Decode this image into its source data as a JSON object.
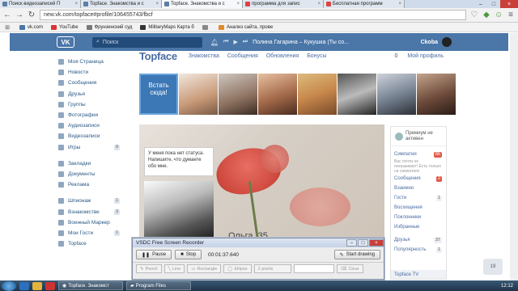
{
  "browser": {
    "tabs": [
      {
        "label": "Поиск видеозаписей П"
      },
      {
        "label": "Topface. Знакомства и с"
      },
      {
        "label": "Topface. Знакомства и с"
      },
      {
        "label": "программа для запис"
      },
      {
        "label": "Бесплатная программ"
      }
    ],
    "url": "new.vk.com/topface#profile/106455743/fbcf",
    "bookmarks": [
      {
        "label": "vk.com",
        "color": "#4a76a8"
      },
      {
        "label": "YouTube",
        "color": "#d33"
      },
      {
        "label": "Фрунзенский суд",
        "color": "#777"
      },
      {
        "label": "MilitaryMaps Карта б",
        "color": "#333"
      },
      {
        "label": "",
        "color": "#888"
      },
      {
        "label": "Анализ сайта, прове",
        "color": "#e08a2c"
      }
    ]
  },
  "vk": {
    "logo": "VK",
    "search_placeholder": "Поиск",
    "track": "Полина Гагарина – Кукушка (Ты со...",
    "user_name": "Ckoba"
  },
  "sidebar": {
    "items": [
      {
        "label": "Моя Страница",
        "badge": ""
      },
      {
        "label": "Новости",
        "badge": ""
      },
      {
        "label": "Сообщения",
        "badge": ""
      },
      {
        "label": "Друзья",
        "badge": ""
      },
      {
        "label": "Группы",
        "badge": ""
      },
      {
        "label": "Фотографии",
        "badge": ""
      },
      {
        "label": "Аудиозаписи",
        "badge": ""
      },
      {
        "label": "Видеозаписи",
        "badge": ""
      },
      {
        "label": "Игры",
        "badge": "9"
      }
    ],
    "items2": [
      {
        "label": "Закладки",
        "badge": ""
      },
      {
        "label": "Документы",
        "badge": ""
      },
      {
        "label": "Реклама",
        "badge": ""
      }
    ],
    "items3": [
      {
        "label": "Шпионаж",
        "badge": "1"
      },
      {
        "label": "Взнакомстве",
        "badge": "3"
      },
      {
        "label": "Военный Маркер",
        "badge": ""
      },
      {
        "label": "Мои Гости",
        "badge": "1"
      },
      {
        "label": "Topface",
        "badge": ""
      }
    ]
  },
  "topface": {
    "logo": "Topface",
    "nav": [
      "Знакомства",
      "Сообщения",
      "Обновления",
      "Бонусы"
    ],
    "count": "0",
    "profile": "Мой профиль",
    "first_photo": "Встать сюда!",
    "status_text": "У меня пока нет статуса. Напишите, что думаете обо мне.",
    "name": "Ольга, 35"
  },
  "right_panel": {
    "premium": "Премиум не активен",
    "sympathy": "Симпатии",
    "sympathy_badge": "86",
    "note": "Вас почти не показывают! Есть только на симпатиях",
    "messages": "Сообщения",
    "messages_badge": "2",
    "items": [
      {
        "label": "Взаимно",
        "badge": ""
      },
      {
        "label": "Гости",
        "badge": "1"
      },
      {
        "label": "Восхищения",
        "badge": ""
      },
      {
        "label": "Поклонники",
        "badge": ""
      },
      {
        "label": "Избранные",
        "badge": ""
      }
    ],
    "friends": "Друзья",
    "friends_badge": "37",
    "popularity": "Популярность",
    "popularity_badge": "1",
    "tv": "Topface TV",
    "float_count": "19"
  },
  "recorder": {
    "title": "VSDC Free Screen Recorder",
    "pause": "Pause",
    "stop": "Stop",
    "time": "00:01:37.640",
    "start": "Start drawing",
    "tools": [
      "Pencil",
      "Line",
      "Rectangle",
      "Ellipse",
      "2 pixels",
      "Clear"
    ]
  },
  "taskbar": {
    "items": [
      "Topface. Знакомст",
      "Program Files"
    ],
    "clock": "12:12"
  }
}
